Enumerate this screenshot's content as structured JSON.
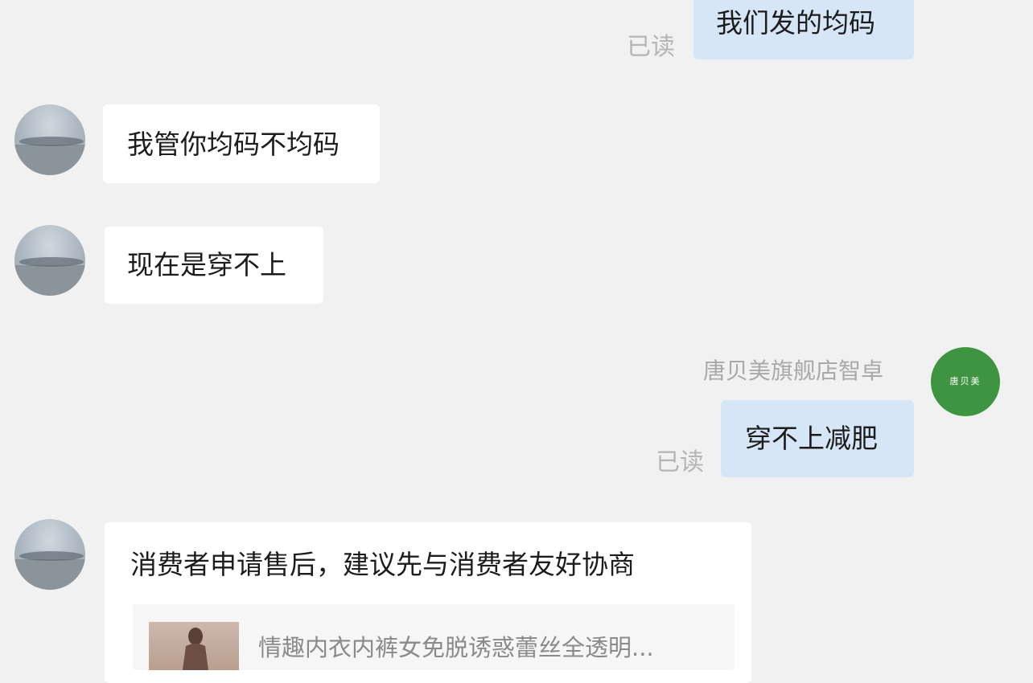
{
  "messages": [
    {
      "direction": "outgoing",
      "text": "我们发的均码",
      "read_status": "已读"
    },
    {
      "direction": "incoming",
      "text": "我管你均码不均码"
    },
    {
      "direction": "incoming",
      "text": "现在是穿不上"
    },
    {
      "direction": "outgoing",
      "sender": "唐贝美旗舰店智卓",
      "text": "穿不上减肥",
      "read_status": "已读"
    },
    {
      "direction": "incoming",
      "text": "消费者申请售后，建议先与消费者友好协商",
      "product": {
        "title": "情趣内衣内裤女免脱诱惑蕾丝全透明..."
      }
    }
  ],
  "shop_avatar": {
    "label": "唐贝美",
    "color": "#3e9440"
  },
  "colors": {
    "outgoing_bubble": "#d7e6f7",
    "incoming_bubble": "#ffffff",
    "background": "#f1f1f1"
  }
}
